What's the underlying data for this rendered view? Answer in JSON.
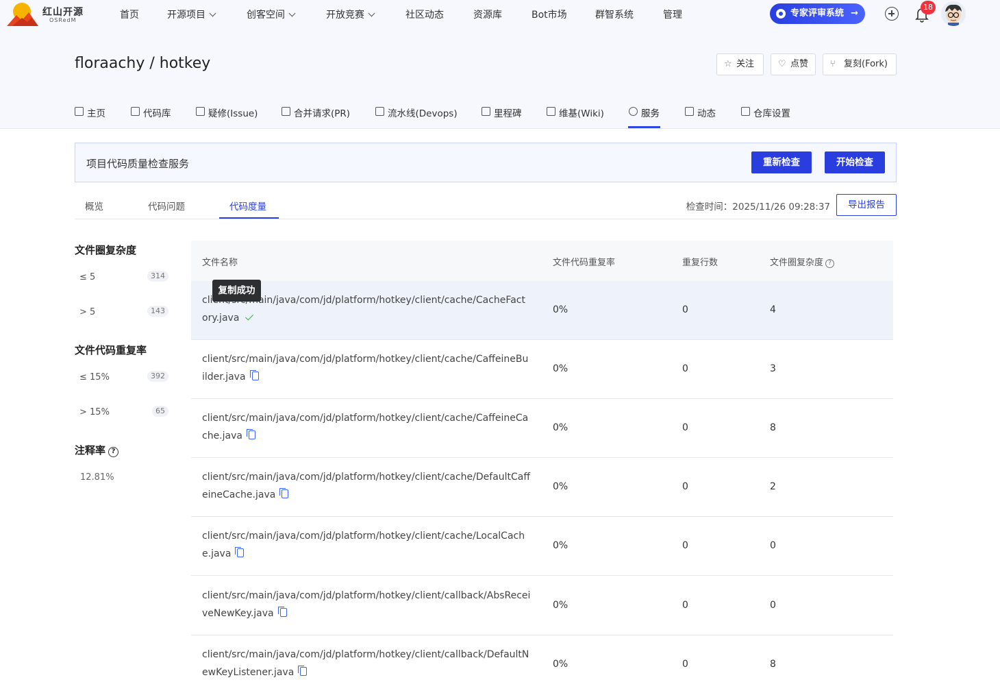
{
  "header": {
    "logo_text": "红山开源",
    "logo_sub": "OSRedM",
    "nav": [
      {
        "label": "首页",
        "has_menu": false
      },
      {
        "label": "开源项目",
        "has_menu": true
      },
      {
        "label": "创客空间",
        "has_menu": true
      },
      {
        "label": "开放竞赛",
        "has_menu": true
      },
      {
        "label": "社区动态",
        "has_menu": false
      },
      {
        "label": "资源库",
        "has_menu": false
      },
      {
        "label": "Bot市场",
        "has_menu": false
      },
      {
        "label": "群智系统",
        "has_menu": false
      },
      {
        "label": "管理",
        "has_menu": false
      }
    ],
    "expert_button": "专家评审系统",
    "notification_count": "18",
    "accent_color": "#2a3ee0"
  },
  "repo": {
    "title": "floraachy / hotkey",
    "actions": {
      "watch": "关注",
      "star": "点赞",
      "fork": "复刻(Fork)"
    },
    "tabs": [
      {
        "label": "主页",
        "icon": "home-icon"
      },
      {
        "label": "代码库",
        "icon": "code-icon"
      },
      {
        "label": "疑修(Issue)",
        "icon": "issue-icon"
      },
      {
        "label": "合并请求(PR)",
        "icon": "pull-request-icon"
      },
      {
        "label": "流水线(Devops)",
        "icon": "pipeline-icon"
      },
      {
        "label": "里程碑",
        "icon": "flag-icon"
      },
      {
        "label": "维基(Wiki)",
        "icon": "book-icon"
      },
      {
        "label": "服务",
        "icon": "service-icon"
      },
      {
        "label": "动态",
        "icon": "activity-icon"
      },
      {
        "label": "仓库设置",
        "icon": "settings-icon"
      }
    ],
    "active_tab": "服务"
  },
  "service": {
    "title": "项目代码质量检查服务",
    "recheck": "重新检查",
    "start": "开始检查",
    "subtabs": [
      "概览",
      "代码问题",
      "代码度量"
    ],
    "active_subtab": "代码度量",
    "check_time": "检查时间：2025/11/26 09:28:37",
    "export": "导出报告"
  },
  "filters": {
    "complexity": {
      "title": "文件圈复杂度",
      "options": [
        {
          "label": "≤ 5",
          "count": "314"
        },
        {
          "label": "> 5",
          "count": "143"
        }
      ]
    },
    "duplication": {
      "title": "文件代码重复率",
      "options": [
        {
          "label": "≤ 15%",
          "count": "392"
        },
        {
          "label": "> 15%",
          "count": "65"
        }
      ]
    },
    "comment": {
      "title": "注释率",
      "value": "12.81%"
    }
  },
  "table": {
    "columns": [
      "文件名称",
      "文件代码重复率",
      "重复行数",
      "文件圈复杂度"
    ],
    "tooltip": "复制成功",
    "rows": [
      {
        "file": "client/src/main/java/com/jd/platform/hotkey/client/cache/CacheFactory.java",
        "dup_rate": "0%",
        "dup_lines": "0",
        "complexity": "4",
        "copied": true
      },
      {
        "file": "client/src/main/java/com/jd/platform/hotkey/client/cache/CaffeineBuilder.java",
        "dup_rate": "0%",
        "dup_lines": "0",
        "complexity": "3",
        "copied": false
      },
      {
        "file": "client/src/main/java/com/jd/platform/hotkey/client/cache/CaffeineCache.java",
        "dup_rate": "0%",
        "dup_lines": "0",
        "complexity": "8",
        "copied": false
      },
      {
        "file": "client/src/main/java/com/jd/platform/hotkey/client/cache/DefaultCaffeineCache.java",
        "dup_rate": "0%",
        "dup_lines": "0",
        "complexity": "2",
        "copied": false
      },
      {
        "file": "client/src/main/java/com/jd/platform/hotkey/client/cache/LocalCache.java",
        "dup_rate": "0%",
        "dup_lines": "0",
        "complexity": "0",
        "copied": false
      },
      {
        "file": "client/src/main/java/com/jd/platform/hotkey/client/callback/AbsReceiveNewKey.java",
        "dup_rate": "0%",
        "dup_lines": "0",
        "complexity": "0",
        "copied": false
      },
      {
        "file": "client/src/main/java/com/jd/platform/hotkey/client/callback/DefaultNewKeyListener.java",
        "dup_rate": "0%",
        "dup_lines": "0",
        "complexity": "8",
        "copied": false
      }
    ]
  }
}
